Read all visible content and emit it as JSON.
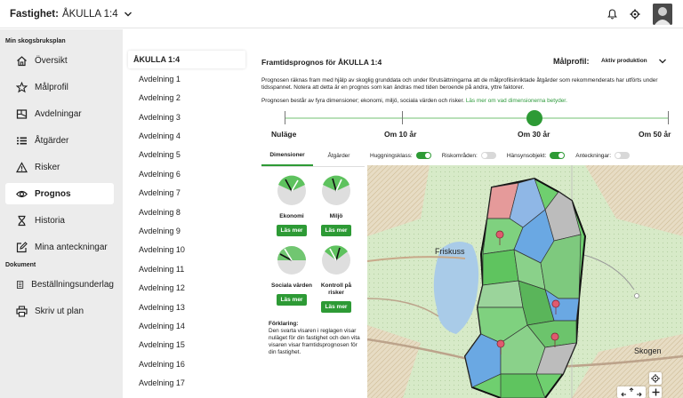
{
  "topbar": {
    "property_label": "Fastighet:",
    "property_value": "ÅKULLA 1:4"
  },
  "sidebar": {
    "section_plan": "Min skogsbruksplan",
    "section_document": "Dokument",
    "items": [
      {
        "label": "Översikt",
        "icon": "home-icon"
      },
      {
        "label": "Målprofil",
        "icon": "star-icon"
      },
      {
        "label": "Avdelningar",
        "icon": "areas-icon"
      },
      {
        "label": "Åtgärder",
        "icon": "list-icon"
      },
      {
        "label": "Risker",
        "icon": "warning-icon"
      },
      {
        "label": "Prognos",
        "icon": "eye-icon"
      },
      {
        "label": "Historia",
        "icon": "hourglass-icon"
      },
      {
        "label": "Mina anteckningar",
        "icon": "edit-icon"
      }
    ],
    "doc_items": [
      {
        "label": "Beställningsunderlag",
        "icon": "document-icon"
      },
      {
        "label": "Skriv ut plan",
        "icon": "printer-icon"
      }
    ],
    "active": "Prognos"
  },
  "list": {
    "items": [
      "ÅKULLA 1:4",
      "Avdelning 1",
      "Avdelning 2",
      "Avdelning 3",
      "Avdelning 4",
      "Avdelning 5",
      "Avdelning 6",
      "Avdelning 7",
      "Avdelning 8",
      "Avdelning 9",
      "Avdelning 10",
      "Avdelning 11",
      "Avdelning 12",
      "Avdelning 13",
      "Avdelning 14",
      "Avdelning 15",
      "Avdelning 16",
      "Avdelning 17"
    ]
  },
  "main": {
    "title": "Framtidsprognos för ÅKULLA 1:4",
    "profile_label": "Målprofil:",
    "profile_value": "Aktiv produktion",
    "desc1": "Prognosen räknas fram med hjälp av skoglig grunddata och under förutsättningarna att de målprofilsinriktade åtgärder som rekommenderats har utförts under tidsspannet. Notera att detta är en prognos som kan ändras med tiden beroende på andra, yttre faktorer.",
    "desc2": "Prognosen består av fyra dimensioner; ekonomi, miljö, sociala värden och risker.",
    "desc2_link": "Läs mer om vad dimensionerna betyder.",
    "timeline": [
      "Nuläge",
      "Om 10 år",
      "Om 30 år",
      "Om 50 år"
    ],
    "timeline_selected": "Om 30 år",
    "tabs": [
      "Dimensioner",
      "Åtgärder"
    ],
    "gauges": [
      {
        "name": "Ekonomi",
        "button": "Läs mer"
      },
      {
        "name": "Miljö",
        "button": "Läs mer"
      },
      {
        "name": "Sociala värden",
        "button": "Läs mer"
      },
      {
        "name": "Kontroll på risker",
        "button": "Läs mer"
      }
    ],
    "legend_title": "Förklaring:",
    "legend_text": "Den svarta visaren i reglagen visar nuläget för din fastighet och den vita visaren visar framtidsprognosen för din fastighet.",
    "toggles": [
      {
        "label": "Huggningsklass:",
        "on": true
      },
      {
        "label": "Riskområden:",
        "on": false
      },
      {
        "label": "Hänsynsobjekt:",
        "on": true
      },
      {
        "label": "Anteckningar:",
        "on": false
      }
    ],
    "map_labels": [
      "Friskuss",
      "Skogen"
    ]
  },
  "colors": {
    "accent": "#2d9a35",
    "sidebar_bg": "#ececec"
  }
}
